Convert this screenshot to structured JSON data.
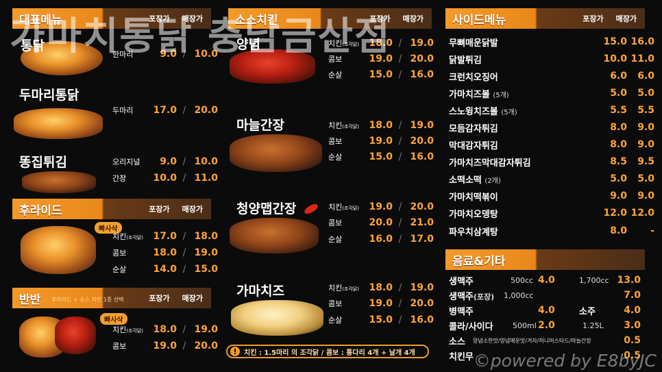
{
  "watermark": "가마치통닭 충남금산점",
  "credit": "©powered by E8byJC",
  "heads": {
    "a": "포장가",
    "b": "매장가"
  },
  "col1": {
    "rep": {
      "title": "대표메뉴",
      "items": [
        {
          "name": "통닭",
          "rows": [
            {
              "label": "한마리",
              "a": "9.0",
              "b": "10.0"
            }
          ]
        },
        {
          "name": "두마리통닭",
          "rows": [
            {
              "label": "두마리",
              "a": "17.0",
              "b": "20.0"
            }
          ]
        },
        {
          "name": "똥집튀김",
          "rows": [
            {
              "label": "오리지널",
              "a": "9.0",
              "b": "10.0"
            },
            {
              "label": "간장",
              "a": "10.0",
              "b": "11.0"
            }
          ]
        }
      ]
    },
    "fried": {
      "title": "후라이드",
      "badge": "빠사삭",
      "rows": [
        {
          "label": "치킨",
          "note": "(조각닭)",
          "a": "17.0",
          "b": "18.0"
        },
        {
          "label": "콤보",
          "a": "18.0",
          "b": "19.0"
        },
        {
          "label": "순살",
          "a": "14.0",
          "b": "15.0"
        }
      ]
    },
    "half": {
      "title": "반반",
      "subtitle": "후라이드 + 소스 치킨 1종 선택",
      "badge": "빠사삭",
      "rows": [
        {
          "label": "치킨",
          "note": "(조각닭)",
          "a": "18.0",
          "b": "19.0"
        },
        {
          "label": "콤보",
          "a": "19.0",
          "b": "20.0"
        }
      ]
    }
  },
  "col2": {
    "title": "소스치킨",
    "groups": [
      {
        "name": "양념",
        "rows": [
          {
            "label": "치킨",
            "note": "(조각닭)",
            "a": "18.0",
            "b": "19.0"
          },
          {
            "label": "콤보",
            "a": "19.0",
            "b": "20.0"
          },
          {
            "label": "순살",
            "a": "15.0",
            "b": "16.0"
          }
        ]
      },
      {
        "name": "마늘간장",
        "rows": [
          {
            "label": "치킨",
            "note": "(조각닭)",
            "a": "18.0",
            "b": "19.0"
          },
          {
            "label": "콤보",
            "a": "19.0",
            "b": "20.0"
          },
          {
            "label": "순살",
            "a": "15.0",
            "b": "16.0"
          }
        ]
      },
      {
        "name": "청양맵간장",
        "rows": [
          {
            "label": "치킨",
            "note": "(조각닭)",
            "a": "19.0",
            "b": "20.0"
          },
          {
            "label": "콤보",
            "a": "20.0",
            "b": "21.0"
          },
          {
            "label": "순살",
            "a": "16.0",
            "b": "17.0"
          }
        ]
      },
      {
        "name": "가마치즈",
        "rows": [
          {
            "label": "치킨",
            "note": "(조각닭)",
            "a": "18.0",
            "b": "19.0"
          },
          {
            "label": "콤보",
            "a": "19.0",
            "b": "20.0"
          },
          {
            "label": "순살",
            "a": "15.0",
            "b": "16.0"
          }
        ]
      }
    ],
    "notice": "치킨 : 1.5마리 의 조각닭 / 콤보 : 통다리 4개 + 날개 4개"
  },
  "col3": {
    "side": {
      "title": "사이드메뉴",
      "items": [
        {
          "name": "무뼈매운닭발",
          "a": "15.0",
          "b": "16.0"
        },
        {
          "name": "닭발튀김",
          "a": "10.0",
          "b": "11.0"
        },
        {
          "name": "크런치오징어",
          "a": "6.0",
          "b": "6.0"
        },
        {
          "name": "가마치즈볼",
          "note": "(5개)",
          "a": "5.0",
          "b": "5.0"
        },
        {
          "name": "스노윙치즈볼",
          "note": "(5개)",
          "a": "5.5",
          "b": "5.5"
        },
        {
          "name": "모듬감자튀김",
          "a": "8.0",
          "b": "9.0"
        },
        {
          "name": "막대감자튀김",
          "a": "8.0",
          "b": "9.0"
        },
        {
          "name": "가마치즈막대감자튀김",
          "a": "8.5",
          "b": "9.5"
        },
        {
          "name": "소떡소떡",
          "note": "(2개)",
          "a": "5.0",
          "b": "5.0"
        },
        {
          "name": "가마치떡볶이",
          "a": "9.0",
          "b": "9.0"
        },
        {
          "name": "가마치오뎅탕",
          "a": "12.0",
          "b": "12.0"
        },
        {
          "name": "파우치삼계탕",
          "a": "8.0",
          "b": "-"
        }
      ]
    },
    "drinks": {
      "title": "음료&기타",
      "beer1": {
        "name": "생맥주",
        "size1": "500cc",
        "p1": "4.0",
        "size2": "1,700cc",
        "p2": "13.0"
      },
      "beer2": {
        "name": "생맥주",
        "note": "(포장)",
        "size": "1,000cc",
        "p": "7.0"
      },
      "bottle": {
        "name": "병맥주",
        "p": "4.0",
        "name2": "소주",
        "p2": "4.0"
      },
      "cola": {
        "name": "콜라/사이다",
        "size1": "500ml",
        "p1": "2.0",
        "size2": "1.25L",
        "p2": "3.0"
      },
      "sauce": {
        "name": "소스",
        "detail": "양념소한맛/양념매운맛/겨자/허니머스타드/마늘간장",
        "p": "0.5"
      },
      "pickle": {
        "name": "치킨무",
        "p": "0.5"
      }
    }
  }
}
